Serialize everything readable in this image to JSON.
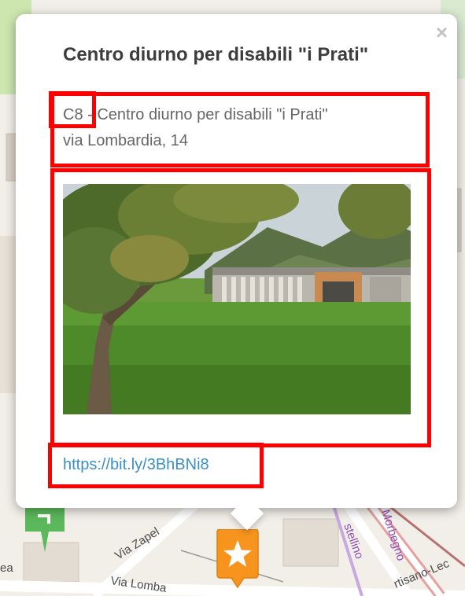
{
  "popup": {
    "title": "Centro diurno per disabili \"i Prati\"",
    "code": "C8",
    "description_rest": " - Centro diurno per disabili \"i Prati\"",
    "address": "via Lombardia, 14",
    "link": "https://bit.ly/3BhBNi8",
    "close_label": "×",
    "photo_alt": "Centro diurno per disabili i Prati"
  },
  "map": {
    "streets": {
      "via_zapel": "Via Zapel",
      "via_lombardia": "Via Lomba",
      "stellino": "stellino",
      "morbegno": "Morbegno",
      "ortisano_lec": "rtisano-Lec",
      "edge_ea": "ea"
    },
    "marker_icon": "star-icon",
    "green_marker_icon": "map-pin-icon"
  },
  "colors": {
    "marker_orange": "#f7941d",
    "highlight_red": "#ff0000",
    "link_blue": "#3a8fc4",
    "green_marker": "#5cb85c"
  }
}
